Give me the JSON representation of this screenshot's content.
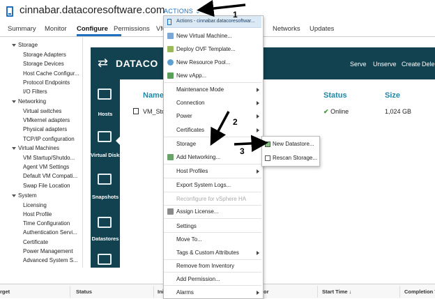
{
  "header": {
    "host_name": "cinnabar.datacoresoftware.com",
    "actions_label": "ACTIONS ⌄"
  },
  "tabs": [
    "Summary",
    "Monitor",
    "Configure",
    "Permissions",
    "VM",
    "Networks",
    "Updates"
  ],
  "tree": [
    {
      "type": "section",
      "label": "Storage"
    },
    {
      "type": "item",
      "label": "Storage Adapters"
    },
    {
      "type": "item",
      "label": "Storage Devices"
    },
    {
      "type": "item",
      "label": "Host Cache Configur..."
    },
    {
      "type": "item",
      "label": "Protocol Endpoints"
    },
    {
      "type": "item",
      "label": "I/O Filters"
    },
    {
      "type": "section",
      "label": "Networking"
    },
    {
      "type": "item",
      "label": "Virtual switches"
    },
    {
      "type": "item",
      "label": "VMkernel adapters"
    },
    {
      "type": "item",
      "label": "Physical adapters"
    },
    {
      "type": "item",
      "label": "TCP/IP configuration"
    },
    {
      "type": "section",
      "label": "Virtual Machines"
    },
    {
      "type": "item",
      "label": "VM Startup/Shutdo..."
    },
    {
      "type": "item",
      "label": "Agent VM Settings"
    },
    {
      "type": "item",
      "label": "Default VM Compati..."
    },
    {
      "type": "item",
      "label": "Swap File Location"
    },
    {
      "type": "section",
      "label": "System"
    },
    {
      "type": "item",
      "label": "Licensing"
    },
    {
      "type": "item",
      "label": "Host Profile"
    },
    {
      "type": "item",
      "label": "Time Configuration"
    },
    {
      "type": "item",
      "label": "Authentication Servi..."
    },
    {
      "type": "item",
      "label": "Certificate"
    },
    {
      "type": "item",
      "label": "Power Management"
    },
    {
      "type": "item",
      "label": "Advanced System S..."
    }
  ],
  "datacore": {
    "logo_text": "DATACO",
    "top_links": [
      "Serve",
      "Unserve",
      "Create",
      "Dele"
    ],
    "side_items": [
      "Hosts",
      "Virtual Disks",
      "Snapshots",
      "Datastores"
    ],
    "columns": [
      "Name",
      "Status",
      "Size"
    ],
    "row": {
      "name": "VM_Sto",
      "status": "Online",
      "size": "1,024 GB"
    }
  },
  "menu": {
    "header": "Actions - cinnabar.datacoresoftwar...",
    "items": [
      {
        "label": "New Virtual Machine...",
        "icon": "new-vm-icon"
      },
      {
        "label": "Deploy OVF Template...",
        "icon": "deploy-ovf-icon"
      },
      {
        "label": "New Resource Pool...",
        "icon": "resource-pool-icon"
      },
      {
        "label": "New vApp...",
        "icon": "vapp-icon"
      },
      {
        "label": "Maintenance Mode",
        "submenu": true
      },
      {
        "label": "Connection",
        "submenu": true
      },
      {
        "label": "Power",
        "submenu": true
      },
      {
        "label": "Certificates",
        "submenu": true
      },
      {
        "label": "Storage",
        "submenu": true
      },
      {
        "label": "Add Networking...",
        "icon": "add-networking-icon"
      },
      {
        "label": "Host Profiles",
        "submenu": true
      },
      {
        "label": "Export System Logs..."
      },
      {
        "label": "Reconfigure for vSphere HA",
        "disabled": true
      },
      {
        "label": "Assign License...",
        "icon": "license-icon"
      },
      {
        "label": "Settings"
      },
      {
        "label": "Move To..."
      },
      {
        "label": "Tags & Custom Attributes",
        "submenu": true
      },
      {
        "label": "Remove from Inventory"
      },
      {
        "label": "Add Permission..."
      },
      {
        "label": "Alarms",
        "submenu": true
      }
    ]
  },
  "submenu": {
    "items": [
      "New Datastore...",
      "Rescan Storage..."
    ]
  },
  "bottom_bar": {
    "columns": [
      "rget",
      "Status",
      "Ini",
      "or",
      "Start Time ↓",
      "Completion Tir"
    ]
  },
  "annotations": [
    "1",
    "2",
    "3"
  ],
  "colors": {
    "accent": "#1e6fbf",
    "datacore_panel": "#12414f",
    "online_green": "#3d9b3d"
  }
}
